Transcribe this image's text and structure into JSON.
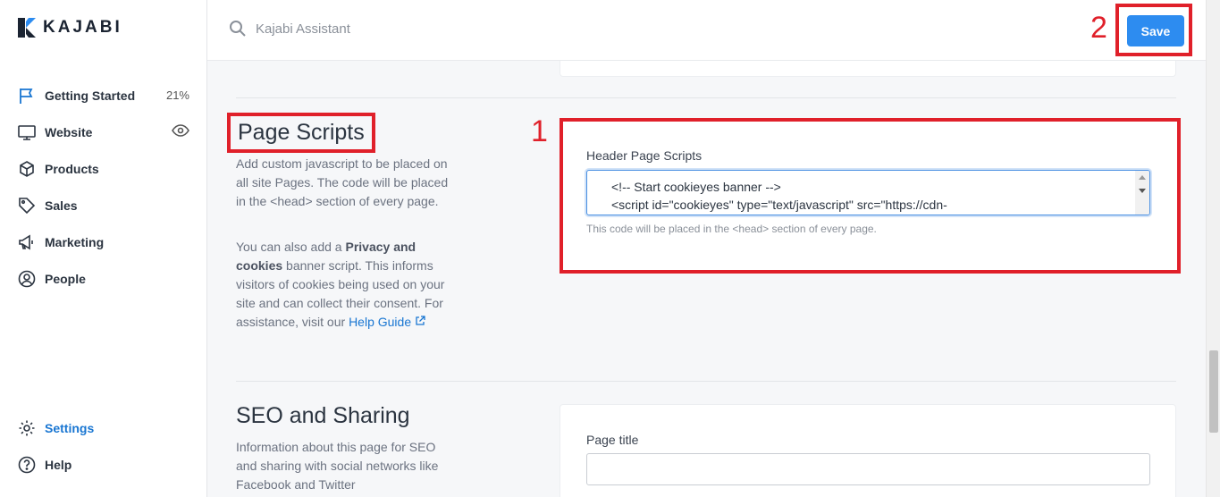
{
  "brand": {
    "logo_text": "KAJABI",
    "accent": "#1976d2",
    "annotation_color": "#e0202a"
  },
  "sidebar": {
    "items": [
      {
        "label": "Getting Started",
        "icon": "flag-icon",
        "meta": "21%"
      },
      {
        "label": "Website",
        "icon": "monitor-icon",
        "meta_icon": "eye-icon"
      },
      {
        "label": "Products",
        "icon": "box-icon"
      },
      {
        "label": "Sales",
        "icon": "tag-icon"
      },
      {
        "label": "Marketing",
        "icon": "megaphone-icon"
      },
      {
        "label": "People",
        "icon": "person-circle-icon"
      }
    ],
    "bottom_items": [
      {
        "label": "Settings",
        "icon": "gear-icon",
        "active": true
      },
      {
        "label": "Help",
        "icon": "question-circle-icon"
      }
    ]
  },
  "topbar": {
    "search_placeholder": "Kajabi Assistant",
    "save_label": "Save",
    "step_2": "2"
  },
  "page_scripts": {
    "title": "Page Scripts",
    "step_1": "1",
    "desc_1": "Add custom javascript to be placed on all site Pages. The code will be placed in the <head> section of every page.",
    "desc_2_pre": "You can also add a ",
    "desc_2_bold": "Privacy and cookies",
    "desc_2_post": " banner script. This informs visitors of cookies being used on your site and can collect their consent. For assistance, visit our ",
    "help_link": "Help Guide",
    "field_label": "Header Page Scripts",
    "field_value_line1": "<!-- Start cookieyes banner -->",
    "field_value_line2": "<script id=\"cookieyes\" type=\"text/javascript\" src=\"https://cdn-",
    "field_hint": "This code will be placed in the <head> section of every page."
  },
  "seo": {
    "title": "SEO and Sharing",
    "desc": "Information about this page for SEO and sharing with social networks like Facebook and Twitter",
    "page_title_label": "Page title",
    "page_title_value": ""
  }
}
